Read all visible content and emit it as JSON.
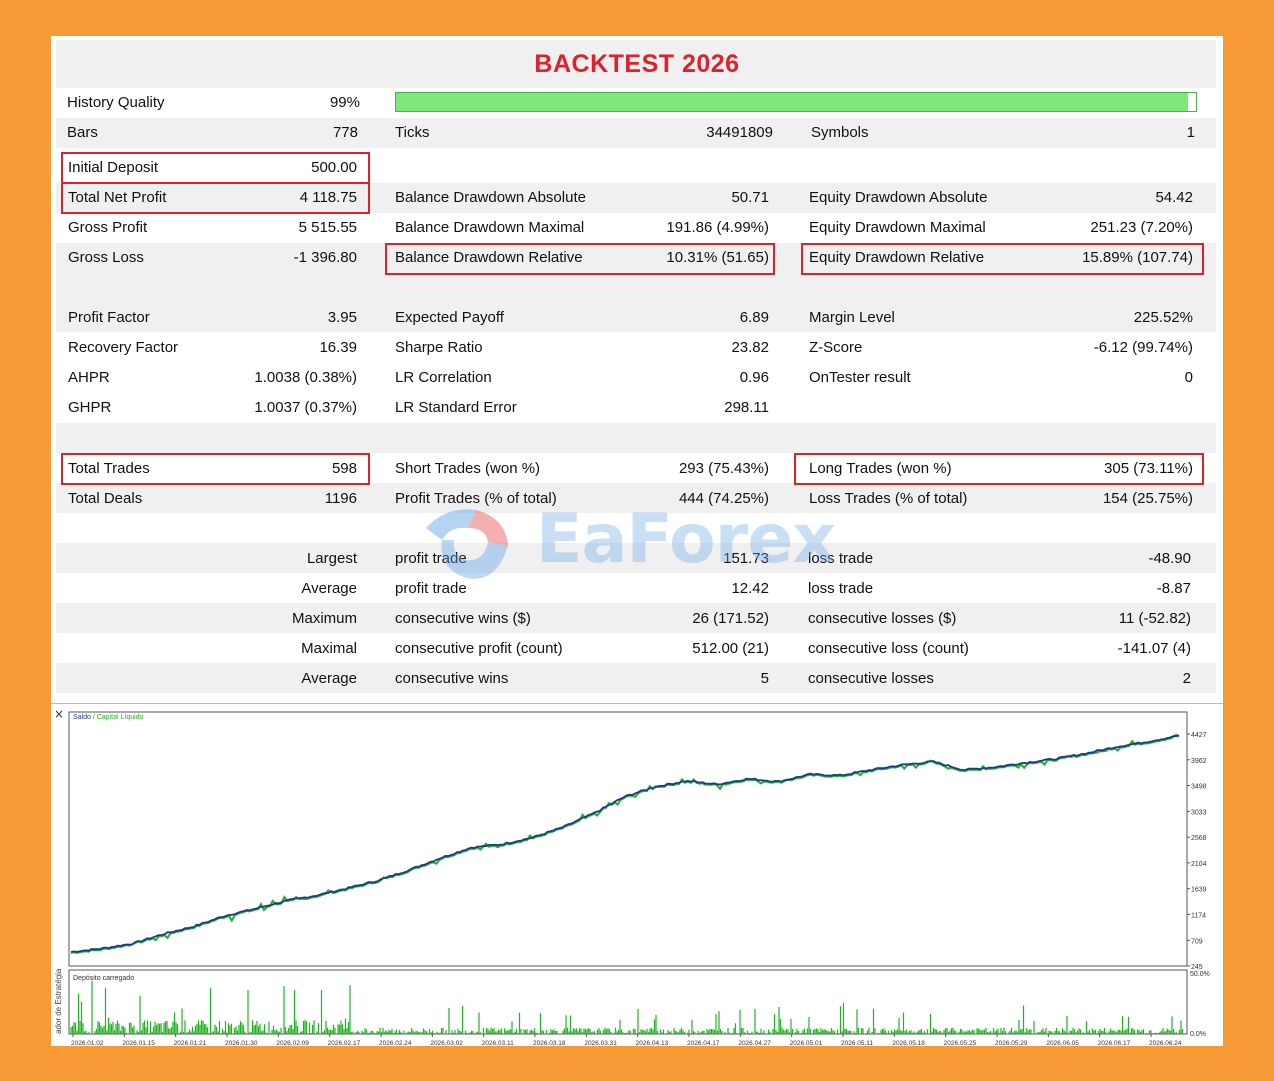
{
  "title": "BACKTEST 2026",
  "history_quality": {
    "label": "History Quality",
    "value": "99%",
    "fill_percent": 99
  },
  "bars": {
    "label": "Bars",
    "value": "778"
  },
  "ticks": {
    "label": "Ticks",
    "value": "34491809"
  },
  "symbols": {
    "label": "Symbols",
    "value": "1"
  },
  "col1": [
    {
      "label": "Initial Deposit",
      "value": "500.00"
    },
    {
      "label": "Total Net Profit",
      "value": "4 118.75"
    },
    {
      "label": "Gross Profit",
      "value": "5 515.55"
    },
    {
      "label": "Gross Loss",
      "value": "-1 396.80"
    },
    {
      "label": "Profit Factor",
      "value": "3.95"
    },
    {
      "label": "Recovery Factor",
      "value": "16.39"
    },
    {
      "label": "AHPR",
      "value": "1.0038 (0.38%)"
    },
    {
      "label": "GHPR",
      "value": "1.0037 (0.37%)"
    },
    {
      "label": "Total Trades",
      "value": "598"
    },
    {
      "label": "Total Deals",
      "value": "1196"
    }
  ],
  "col2": [
    {
      "label": "Balance Drawdown Absolute",
      "value": "50.71"
    },
    {
      "label": "Balance Drawdown Maximal",
      "value": "191.86 (4.99%)"
    },
    {
      "label": "Balance Drawdown Relative",
      "value": "10.31% (51.65)"
    },
    {
      "label": "Expected Payoff",
      "value": "6.89"
    },
    {
      "label": "Sharpe Ratio",
      "value": "23.82"
    },
    {
      "label": "LR Correlation",
      "value": "0.96"
    },
    {
      "label": "LR Standard Error",
      "value": "298.11"
    },
    {
      "label": "Short Trades (won %)",
      "value": "293 (75.43%)"
    },
    {
      "label": "Profit Trades (% of total)",
      "value": "444 (74.25%)"
    }
  ],
  "col3": [
    {
      "label": "Equity Drawdown Absolute",
      "value": "54.42"
    },
    {
      "label": "Equity Drawdown Maximal",
      "value": "251.23 (7.20%)"
    },
    {
      "label": "Equity Drawdown Relative",
      "value": "15.89% (107.74)"
    },
    {
      "label": "Margin Level",
      "value": "225.52%"
    },
    {
      "label": "Z-Score",
      "value": "-6.12 (99.74%)"
    },
    {
      "label": "OnTester result",
      "value": "0"
    },
    {
      "label": "Long Trades (won %)",
      "value": "305 (73.11%)"
    },
    {
      "label": "Loss Trades (% of total)",
      "value": "154 (25.75%)"
    }
  ],
  "stats": [
    {
      "prefix": "Largest",
      "profit_label": "profit trade",
      "profit_value": "151.73",
      "loss_label": "loss trade",
      "loss_value": "-48.90"
    },
    {
      "prefix": "Average",
      "profit_label": "profit trade",
      "profit_value": "12.42",
      "loss_label": "loss trade",
      "loss_value": "-8.87"
    },
    {
      "prefix": "Maximum",
      "profit_label": "consecutive wins ($)",
      "profit_value": "26 (171.52)",
      "loss_label": "consecutive losses ($)",
      "loss_value": "11 (-52.82)"
    },
    {
      "prefix": "Maximal",
      "profit_label": "consecutive profit (count)",
      "profit_value": "512.00 (21)",
      "loss_label": "consecutive loss (count)",
      "loss_value": "-141.07 (4)"
    },
    {
      "prefix": "Average",
      "profit_label": "consecutive wins",
      "profit_value": "5",
      "loss_label": "consecutive losses",
      "loss_value": "2"
    }
  ],
  "watermark": "EaForex",
  "colors": {
    "title": "#e0202a",
    "highlight_box": "#e2202a",
    "quality_bar": "#7fe67a",
    "balance": "#1d3a8a",
    "equity": "#22b022",
    "deposit_load": "#1fb51f"
  },
  "chart_data": {
    "type": "line",
    "close_label": "×",
    "legend": {
      "balance": "Saldo",
      "sep": " / ",
      "equity": "Capital Líquido"
    },
    "y_ticks": [
      "4427",
      "3962",
      "3498",
      "3033",
      "2568",
      "2104",
      "1639",
      "1174",
      "709",
      "245"
    ],
    "ylim": [
      245,
      4427
    ],
    "x_ticks": [
      "2026.01.02",
      "2026.01.15",
      "2026.01.21",
      "2026.01.30",
      "2026.02.09",
      "2026.02.17",
      "2026.02.24",
      "2026.03.02",
      "2026.03.11",
      "2026.03.18",
      "2026.03.31",
      "2026.04.13",
      "2026.04.17",
      "2026.04.27",
      "2026.05.01",
      "2026.05.11",
      "2026.05.18",
      "2026.05.25",
      "2026.05.29",
      "2026.06.05",
      "2026.06.17",
      "2026.06.24"
    ],
    "series": [
      {
        "name": "Saldo",
        "values": [
          500,
          560,
          650,
          820,
          960,
          1150,
          1280,
          1420,
          1520,
          1650,
          1790,
          1980,
          2190,
          2380,
          2440,
          2560,
          2750,
          3000,
          3300,
          3480,
          3580,
          3520,
          3620,
          3570,
          3700,
          3680,
          3780,
          3870,
          3930,
          3780,
          3830,
          3910,
          3980,
          4080,
          4200,
          4290,
          4400
        ]
      }
    ],
    "load_panel": {
      "label": "Depósito carregado",
      "max_label": "50.0%",
      "min_label": "0.0%"
    },
    "side_label": "ador de Estratégia"
  }
}
